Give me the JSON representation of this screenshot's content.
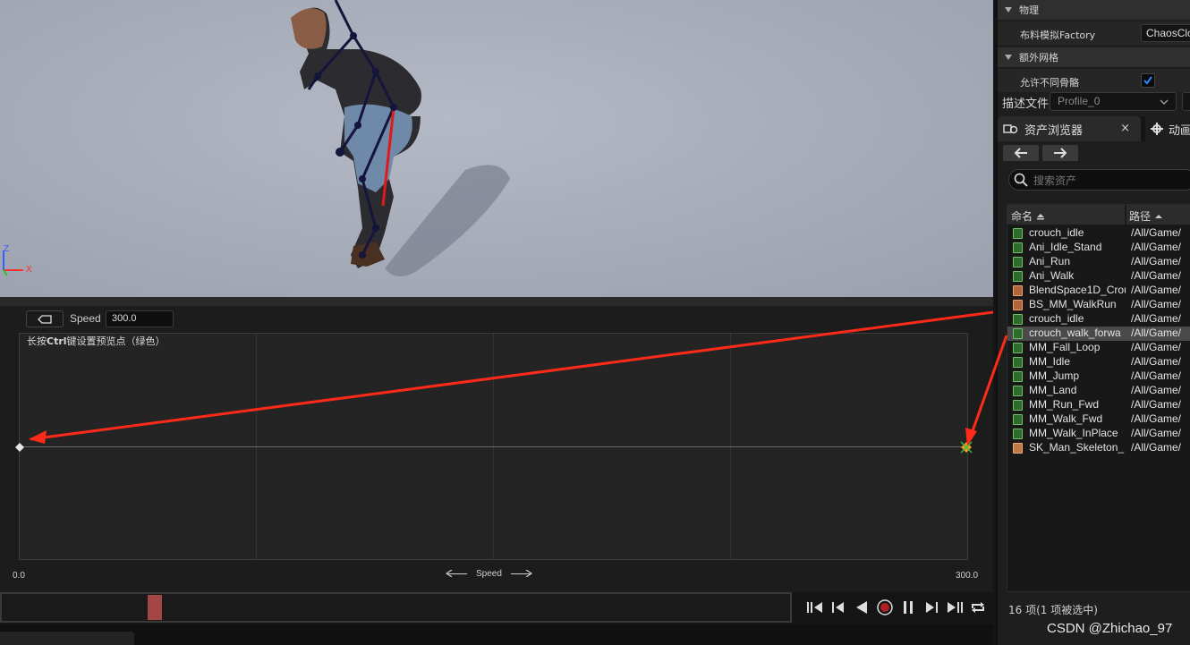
{
  "viewport": {
    "axis_z": "Z",
    "axis_x": "X"
  },
  "blendspace": {
    "speed_label": "Speed",
    "speed_value": "300.0",
    "hint_prefix": "长按",
    "hint_key": "Ctrl",
    "hint_suffix": "键设置预览点（绿色）",
    "axis_min": "0.0",
    "axis_max": "300.0",
    "axis_name": "Speed"
  },
  "timeline": {
    "playhead_fraction": 0.185
  },
  "details": {
    "physics_header": "物理",
    "cloth_factory_label": "布料模拟Factory",
    "cloth_factory_value": "ChaosClo",
    "extra_mesh_header": "额外网格",
    "allow_diff_skeleton_label": "允许不同骨骼",
    "allow_diff_skeleton_checked": true,
    "profile_label": "描述文件",
    "profile_value": "Profile_0"
  },
  "tabs": {
    "asset_browser": "资产浏览器",
    "animation": "动画"
  },
  "search": {
    "placeholder": "搜索资产"
  },
  "asset_list": {
    "col_name": "命名",
    "col_path": "路径",
    "rows": [
      {
        "name": "crouch_idle",
        "path": "/All/Game/",
        "type": "anim"
      },
      {
        "name": "Ani_Idle_Stand",
        "path": "/All/Game/",
        "type": "anim"
      },
      {
        "name": "Ani_Run",
        "path": "/All/Game/",
        "type": "anim"
      },
      {
        "name": "Ani_Walk",
        "path": "/All/Game/",
        "type": "anim"
      },
      {
        "name": "BlendSpace1D_Crou",
        "path": "/All/Game/",
        "type": "bs"
      },
      {
        "name": "BS_MM_WalkRun",
        "path": "/All/Game/",
        "type": "bs"
      },
      {
        "name": "crouch_idle",
        "path": "/All/Game/",
        "type": "anim"
      },
      {
        "name": "crouch_walk_forwa",
        "path": "/All/Game/",
        "type": "anim"
      },
      {
        "name": "MM_Fall_Loop",
        "path": "/All/Game/",
        "type": "anim"
      },
      {
        "name": "MM_Idle",
        "path": "/All/Game/",
        "type": "anim"
      },
      {
        "name": "MM_Jump",
        "path": "/All/Game/",
        "type": "anim"
      },
      {
        "name": "MM_Land",
        "path": "/All/Game/",
        "type": "anim"
      },
      {
        "name": "MM_Run_Fwd",
        "path": "/All/Game/",
        "type": "anim"
      },
      {
        "name": "MM_Walk_Fwd",
        "path": "/All/Game/",
        "type": "anim"
      },
      {
        "name": "MM_Walk_InPlace",
        "path": "/All/Game/",
        "type": "anim"
      },
      {
        "name": "SK_Man_Skeleton_",
        "path": "/All/Game/",
        "type": "sk"
      }
    ],
    "selected_index": 7,
    "status": "16 项(1 项被选中)"
  },
  "watermark": "CSDN @Zhichao_97",
  "colors": {
    "annotation_red": "#ff2a1a",
    "playhead": "#a24646",
    "sample_point_selected": "#e89a2a",
    "selection_row": "#4a4a4a"
  }
}
